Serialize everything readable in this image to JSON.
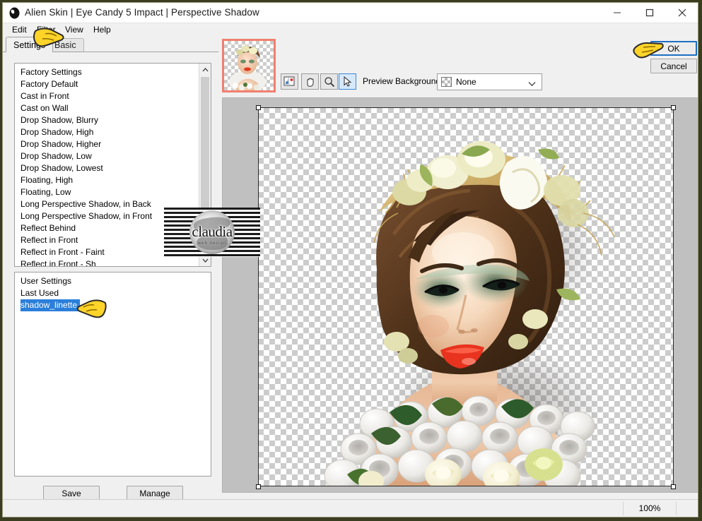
{
  "window": {
    "title": "Alien Skin | Eye Candy 5 Impact | Perspective Shadow",
    "app_icon": "alien-skin-icon",
    "minimize": "minimize-icon",
    "maximize": "maximize-icon",
    "close": "close-icon"
  },
  "menubar": {
    "items": [
      {
        "label": "Edit"
      },
      {
        "label": "Filter"
      },
      {
        "label": "View"
      },
      {
        "label": "Help"
      }
    ]
  },
  "tabs": [
    {
      "label": "Settings",
      "active": true
    },
    {
      "label": "Basic",
      "active": false
    }
  ],
  "factory_settings": {
    "header": "Factory Settings",
    "items": [
      "Factory Default",
      "Cast in Front",
      "Cast on Wall",
      "Drop Shadow, Blurry",
      "Drop Shadow, High",
      "Drop Shadow, Higher",
      "Drop Shadow, Low",
      "Drop Shadow, Lowest",
      "Floating, High",
      "Floating, Low",
      "Long Perspective Shadow, in Back",
      "Long Perspective Shadow, in Front",
      "Reflect Behind",
      "Reflect in Front",
      "Reflect in Front - Faint",
      "Reflect in Front - Sh"
    ]
  },
  "user_settings": {
    "header": "User Settings",
    "items": [
      {
        "label": "Last Used",
        "selected": false
      },
      {
        "label": "shadow_linette",
        "selected": true
      }
    ]
  },
  "panel_buttons": {
    "save": "Save",
    "manage": "Manage"
  },
  "toolbar": {
    "tools": [
      {
        "name": "compare-preview-icon",
        "active": false
      },
      {
        "name": "hand-tool-icon",
        "active": false
      },
      {
        "name": "zoom-tool-icon",
        "active": false
      },
      {
        "name": "arrow-tool-icon",
        "active": true
      }
    ],
    "preview_background_label": "Preview Background:",
    "preview_background_value": "None",
    "preview_background_options": [
      "None"
    ]
  },
  "dialog_buttons": {
    "ok": "OK",
    "cancel": "Cancel"
  },
  "statusbar": {
    "zoom": "100%"
  },
  "watermark": {
    "text": "claudia",
    "subtext": "web design"
  },
  "colors": {
    "selection_blue": "#2a7fda",
    "focus_blue": "#1d6fc4",
    "thumb_border": "#f08070",
    "canvas_bg": "#c0c0c0",
    "window_bg": "#f0f0f0",
    "desktop": "#3b3d21"
  }
}
